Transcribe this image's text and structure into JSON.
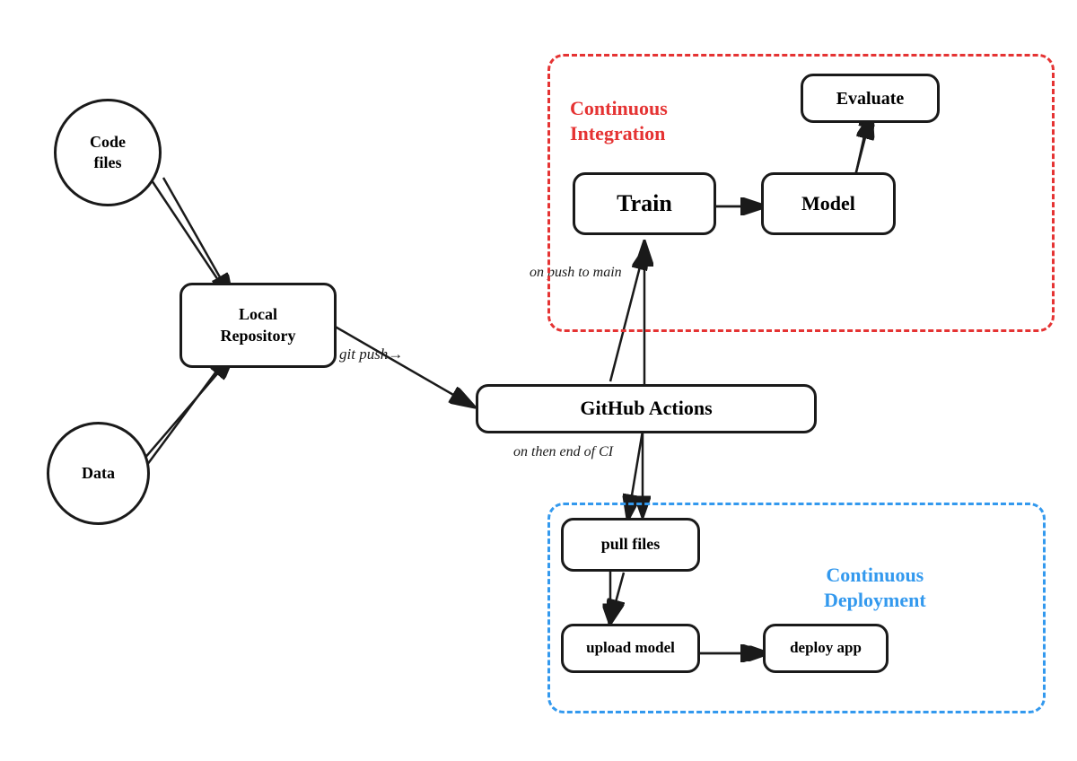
{
  "nodes": {
    "code_files": {
      "label": "Code\nfiles"
    },
    "data": {
      "label": "Data"
    },
    "local_repo": {
      "label": "Local\nRepository"
    },
    "github_actions": {
      "label": "GitHub Actions"
    },
    "train": {
      "label": "Train"
    },
    "model": {
      "label": "Model"
    },
    "evaluate": {
      "label": "Evaluate"
    },
    "pull_files": {
      "label": "pull files"
    },
    "upload_model": {
      "label": "upload model"
    },
    "deploy_app": {
      "label": "deploy app"
    }
  },
  "labels": {
    "git_push": "git push→",
    "on_push_main": "on push to main",
    "on_end_ci": "on then end of CI",
    "continuous_integration": "Continuous\nIntegration",
    "continuous_deployment": "Continuous\nDeployment"
  },
  "colors": {
    "red": "#e53333",
    "blue": "#3399ee",
    "black": "#1a1a1a",
    "white": "#ffffff"
  }
}
